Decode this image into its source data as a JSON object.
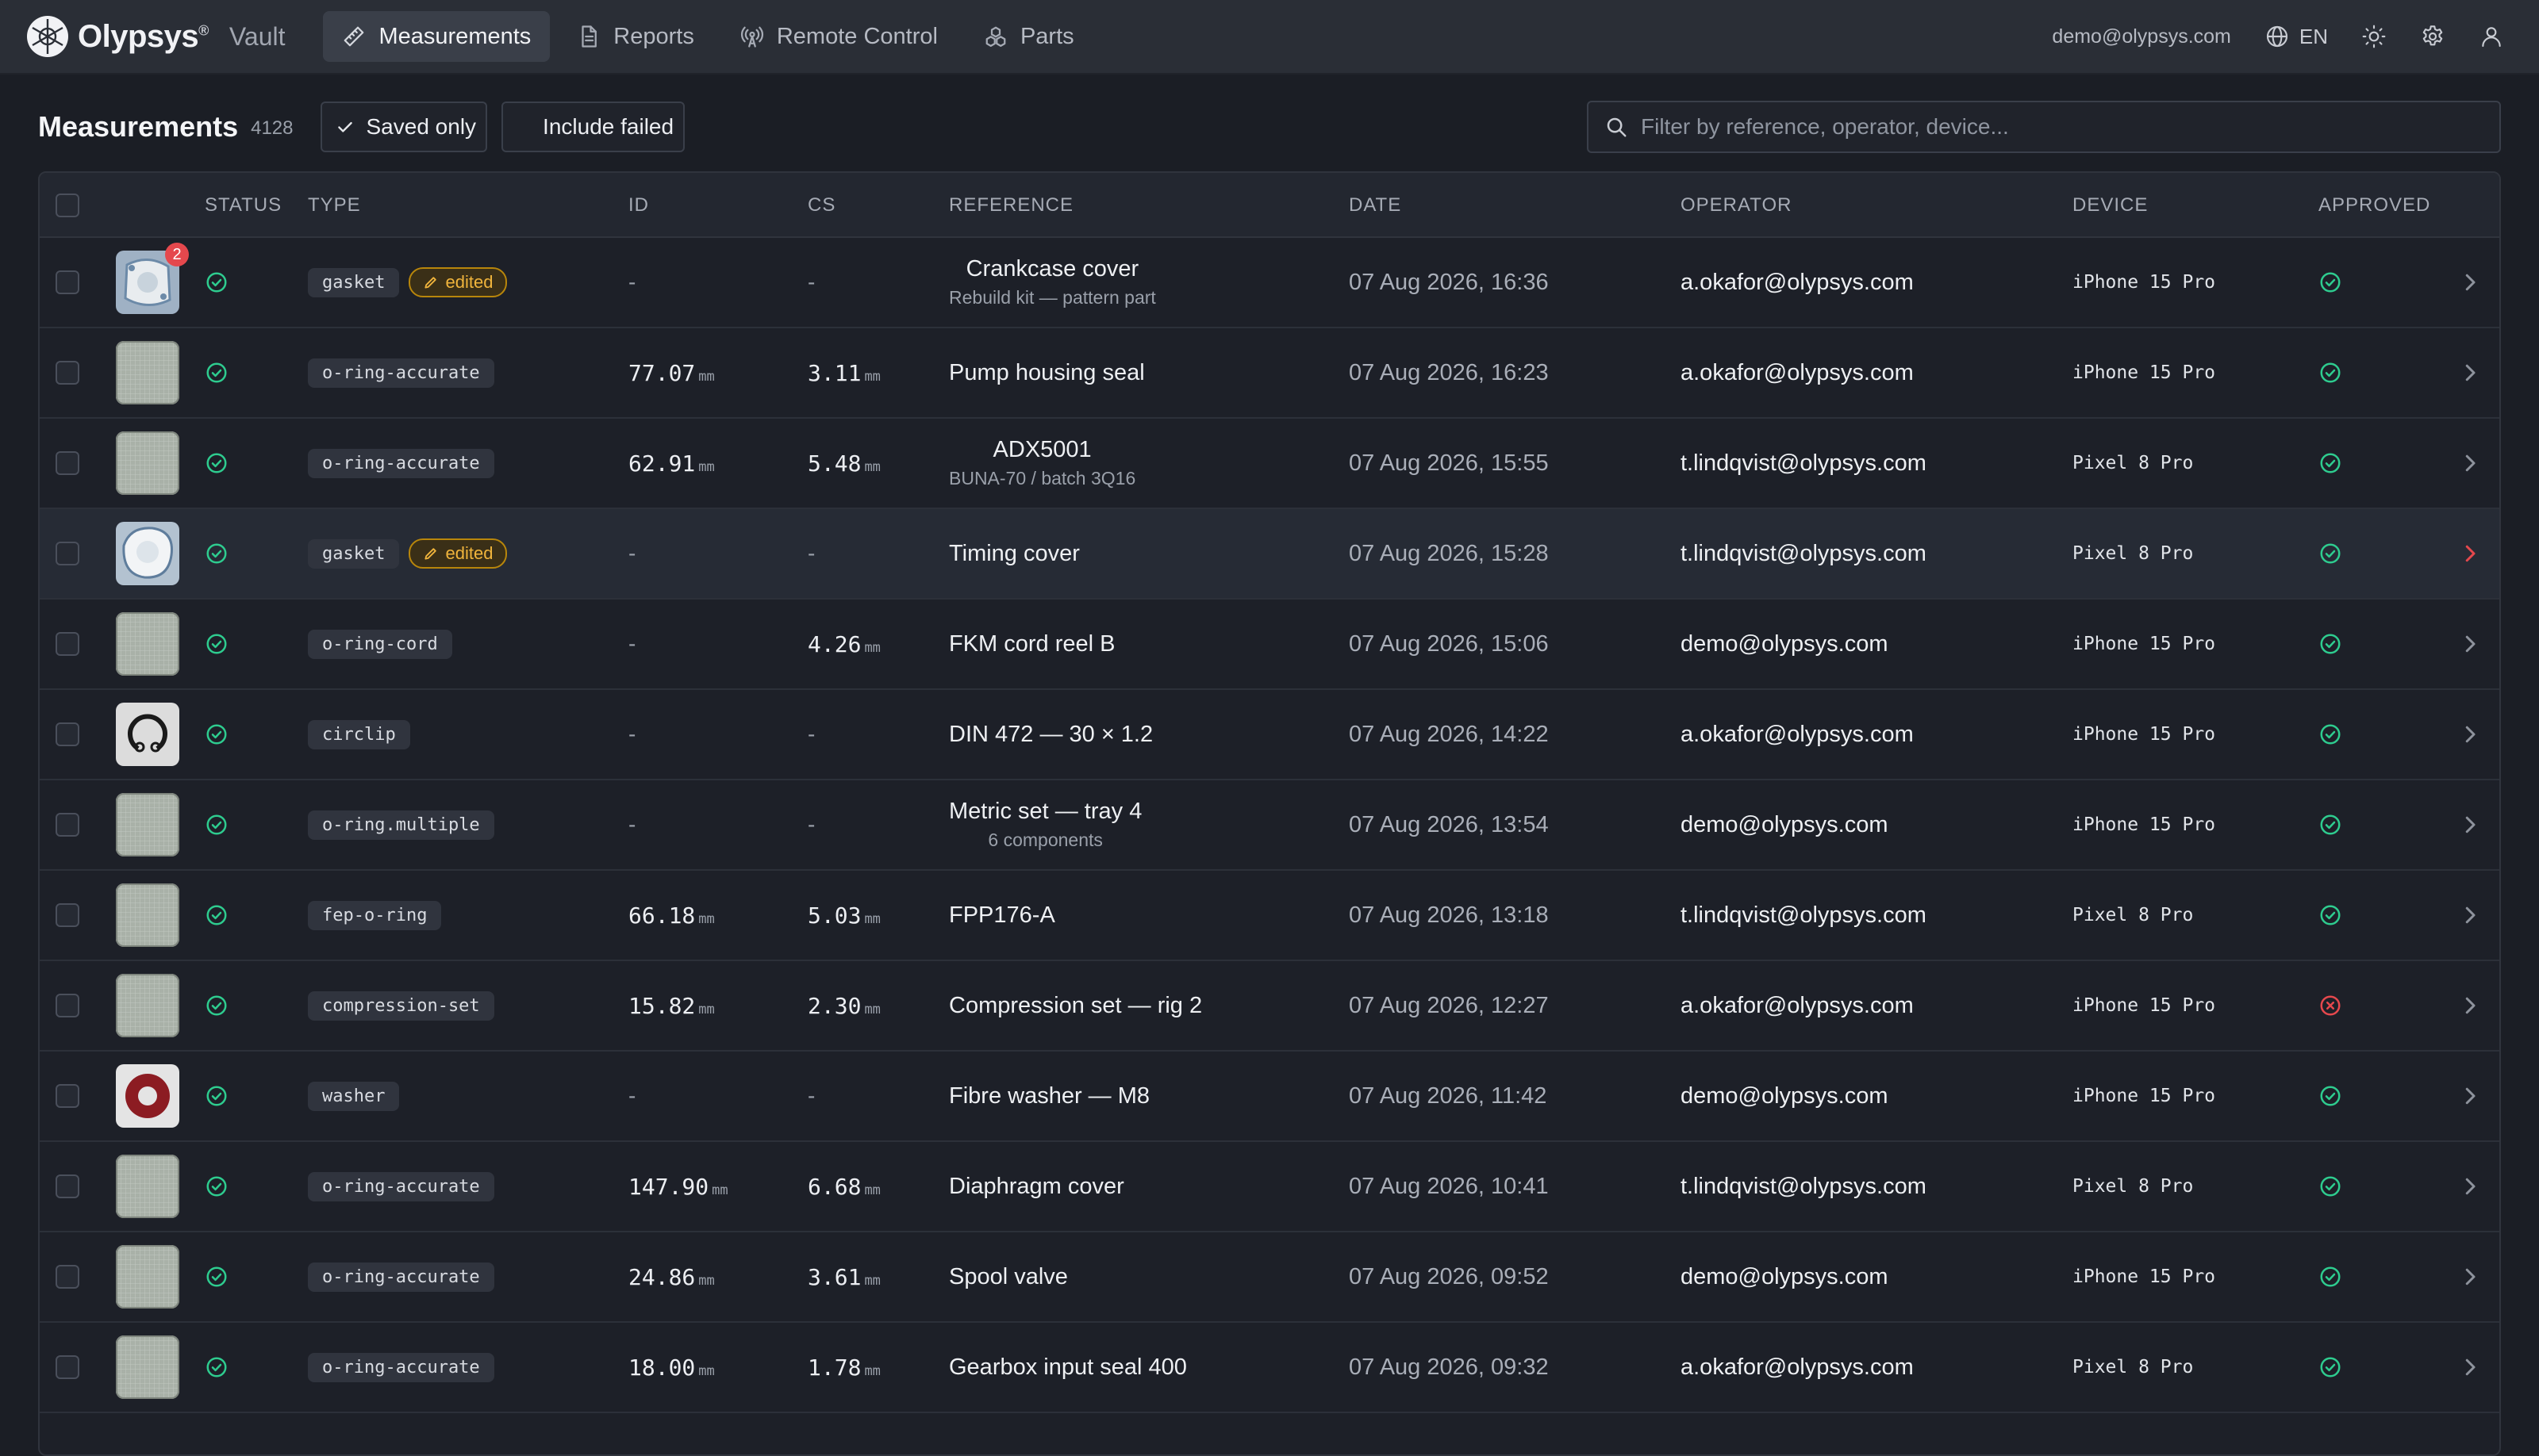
{
  "brand": {
    "name": "Olypsys",
    "sup": "®",
    "product": "Vault"
  },
  "nav": [
    {
      "label": "Measurements",
      "icon": "ruler-icon",
      "active": true
    },
    {
      "label": "Reports",
      "icon": "document-icon",
      "active": false
    },
    {
      "label": "Remote Control",
      "icon": "antenna-icon",
      "active": false
    },
    {
      "label": "Parts",
      "icon": "boxes-icon",
      "active": false
    }
  ],
  "user": {
    "email": "demo@olypsys.com",
    "language": "EN"
  },
  "page": {
    "title": "Measurements",
    "count": "4128",
    "saved_only_label": "Saved only",
    "include_failed_label": "Include failed",
    "search_placeholder": "Filter by reference, operator, device..."
  },
  "columns": {
    "status": "STATUS",
    "type": "TYPE",
    "id": "ID",
    "cs": "CS",
    "reference": "REFERENCE",
    "date": "DATE",
    "operator": "OPERATOR",
    "device": "DEVICE",
    "approved": "APPROVED"
  },
  "unit": "mm",
  "colors": {
    "ok": "#2ecc8f",
    "fail": "#e5484d",
    "accent": "#e5484d",
    "edited": "#f0b43c"
  },
  "rows": [
    {
      "thumb": "gasket-a",
      "badge": "2",
      "type": "gasket",
      "edited": true,
      "edited_label": "edited",
      "id": "-",
      "cs": "-",
      "ref": "Crankcase cover",
      "ref_sub": "Rebuild kit — pattern part",
      "date": "07 Aug 2026, 16:36",
      "operator": "a.okafor@olypsys.com",
      "device": "iPhone 15 Pro",
      "approved": true
    },
    {
      "thumb": "grid",
      "type": "o-ring-accurate",
      "id": "77.07",
      "cs": "3.11",
      "ref": "Pump housing seal",
      "date": "07 Aug 2026, 16:23",
      "operator": "a.okafor@olypsys.com",
      "device": "iPhone 15 Pro",
      "approved": true
    },
    {
      "thumb": "grid",
      "type": "o-ring-accurate",
      "id": "62.91",
      "cs": "5.48",
      "ref": "ADX5001",
      "ref_sub": "BUNA-70 / batch 3Q16",
      "date": "07 Aug 2026, 15:55",
      "operator": "t.lindqvist@olypsys.com",
      "device": "Pixel 8 Pro",
      "approved": true
    },
    {
      "thumb": "gasket-b",
      "type": "gasket",
      "edited": true,
      "edited_label": "edited",
      "id": "-",
      "cs": "-",
      "ref": "Timing cover",
      "date": "07 Aug 2026, 15:28",
      "operator": "t.lindqvist@olypsys.com",
      "device": "Pixel 8 Pro",
      "approved": true,
      "highlight": true
    },
    {
      "thumb": "grid",
      "type": "o-ring-cord",
      "id": "-",
      "cs": "4.26",
      "ref": "FKM cord reel B",
      "date": "07 Aug 2026, 15:06",
      "operator": "demo@olypsys.com",
      "device": "iPhone 15 Pro",
      "approved": true
    },
    {
      "thumb": "circlip",
      "type": "circlip",
      "id": "-",
      "cs": "-",
      "ref": "DIN 472 — 30 × 1.2",
      "date": "07 Aug 2026, 14:22",
      "operator": "a.okafor@olypsys.com",
      "device": "iPhone 15 Pro",
      "approved": true
    },
    {
      "thumb": "grid",
      "type": "o-ring.multiple",
      "id": "-",
      "cs": "-",
      "ref": "Metric set — tray 4",
      "ref_sub": "6 components",
      "date": "07 Aug 2026, 13:54",
      "operator": "demo@olypsys.com",
      "device": "iPhone 15 Pro",
      "approved": true
    },
    {
      "thumb": "grid",
      "type": "fep-o-ring",
      "id": "66.18",
      "cs": "5.03",
      "ref": "FPP176-A",
      "date": "07 Aug 2026, 13:18",
      "operator": "t.lindqvist@olypsys.com",
      "device": "Pixel 8 Pro",
      "approved": true
    },
    {
      "thumb": "grid",
      "type": "compression-set",
      "id": "15.82",
      "cs": "2.30",
      "ref": "Compression set — rig 2",
      "date": "07 Aug 2026, 12:27",
      "operator": "a.okafor@olypsys.com",
      "device": "iPhone 15 Pro",
      "approved": false
    },
    {
      "thumb": "washer",
      "type": "washer",
      "id": "-",
      "cs": "-",
      "ref": "Fibre washer — M8",
      "date": "07 Aug 2026, 11:42",
      "operator": "demo@olypsys.com",
      "device": "iPhone 15 Pro",
      "approved": true
    },
    {
      "thumb": "grid",
      "type": "o-ring-accurate",
      "id": "147.90",
      "cs": "6.68",
      "ref": "Diaphragm cover",
      "date": "07 Aug 2026, 10:41",
      "operator": "t.lindqvist@olypsys.com",
      "device": "Pixel 8 Pro",
      "approved": true
    },
    {
      "thumb": "grid",
      "type": "o-ring-accurate",
      "id": "24.86",
      "cs": "3.61",
      "ref": "Spool valve",
      "date": "07 Aug 2026, 09:52",
      "operator": "demo@olypsys.com",
      "device": "iPhone 15 Pro",
      "approved": true
    },
    {
      "thumb": "grid",
      "type": "o-ring-accurate",
      "id": "18.00",
      "cs": "1.78",
      "ref": "Gearbox input seal 400",
      "date": "07 Aug 2026, 09:32",
      "operator": "a.okafor@olypsys.com",
      "device": "Pixel 8 Pro",
      "approved": true
    }
  ]
}
